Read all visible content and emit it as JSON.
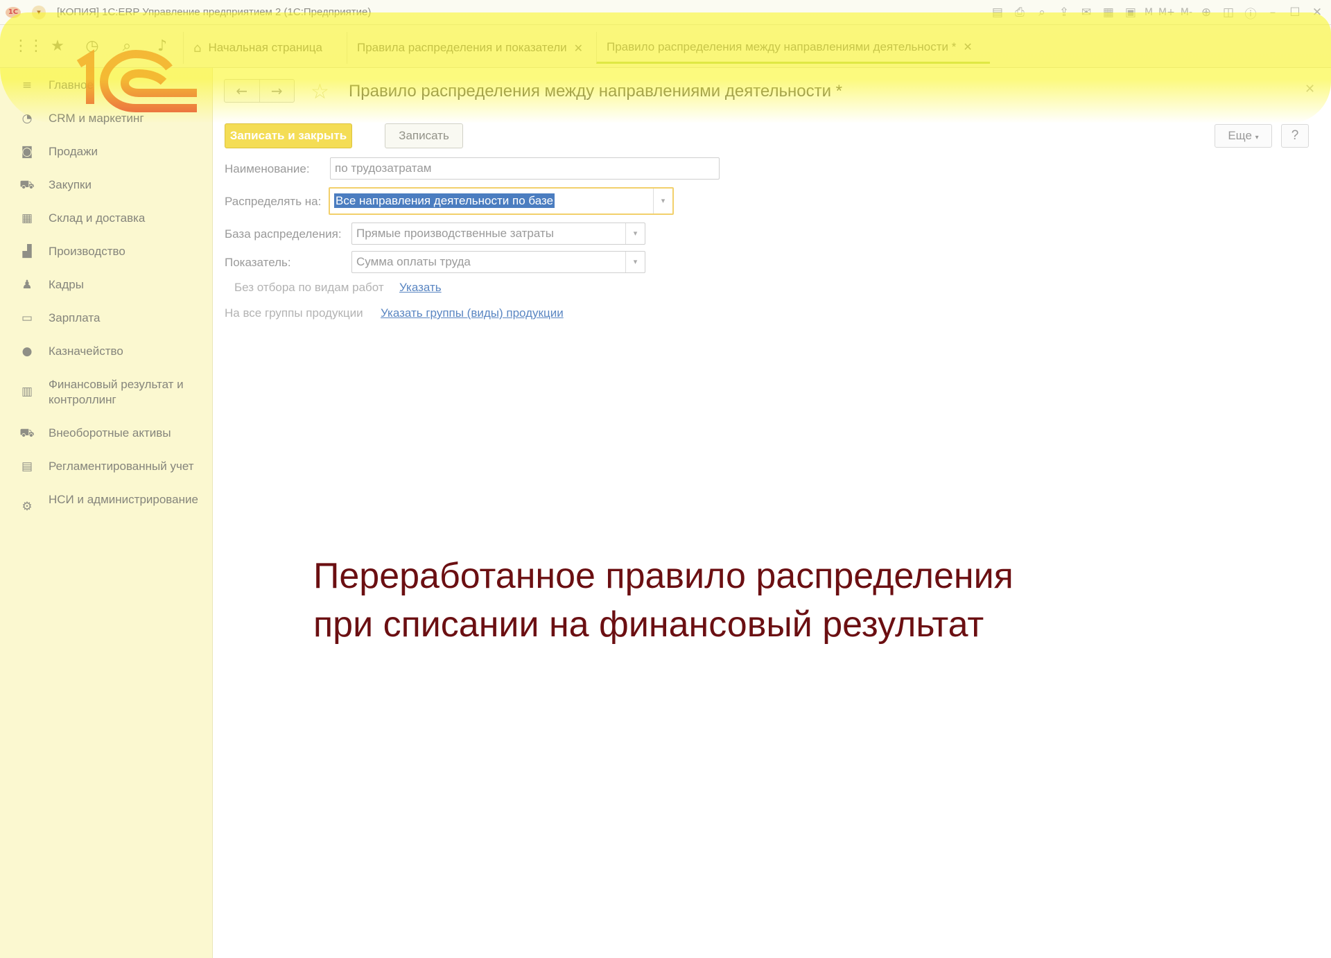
{
  "window": {
    "title": "[КОПИЯ] 1С:ERP Управление предприятием 2  (1С:Предприятие)",
    "toolbar_text": [
      "M",
      "M+",
      "M-"
    ]
  },
  "tabs": [
    {
      "label": "Начальная страница"
    },
    {
      "label": "Правила распределения и показатели"
    },
    {
      "label": "Правило распределения между направлениями деятельности *"
    }
  ],
  "sidebar": {
    "items": [
      {
        "label": "Главное",
        "icon": "menu-lines-icon"
      },
      {
        "label": "CRM и маркетинг",
        "icon": "pie-chart-icon"
      },
      {
        "label": "Продажи",
        "icon": "shopping-bag-icon"
      },
      {
        "label": "Закупки",
        "icon": "cart-icon"
      },
      {
        "label": "Склад и доставка",
        "icon": "warehouse-grid-icon"
      },
      {
        "label": "Производство",
        "icon": "factory-icon"
      },
      {
        "label": "Кадры",
        "icon": "person-icon"
      },
      {
        "label": "Зарплата",
        "icon": "card-icon"
      },
      {
        "label": "Казначейство",
        "icon": "ruble-coin-icon"
      },
      {
        "label": "Финансовый результат и контроллинг",
        "icon": "bar-chart-icon"
      },
      {
        "label": "Внеоборотные активы",
        "icon": "truck-icon"
      },
      {
        "label": "Регламентированный учет",
        "icon": "calculator-icon"
      },
      {
        "label": "НСИ и администрирование",
        "icon": "gear-icon"
      }
    ]
  },
  "form": {
    "title": "Правило распределения между направлениями деятельности *",
    "buttons": {
      "save_close": "Записать и закрыть",
      "save": "Записать",
      "more": "Еще",
      "help": "?"
    },
    "name_label": "Наименование:",
    "name_value": "по трудозатратам",
    "distribute_label": "Распределять на:",
    "distribute_value": "Все направления деятельности по базе",
    "base_label": "База распределения:",
    "base_value": "Прямые производственные затраты",
    "indicator_label": "Показатель:",
    "indicator_value": "Сумма оплаты труда",
    "work_filter_text": "Без отбора по видам работ",
    "work_filter_link": "Указать",
    "product_groups_text": "На все группы продукции",
    "product_groups_link": "Указать группы (виды) продукции"
  },
  "caption": {
    "line1": "Переработанное правило распределения",
    "line2": "при списании на финансовый результат"
  },
  "colors": {
    "highlight": "#faf628",
    "sidebar_bg": "#fbf8d0",
    "primary_button": "#f4dd55",
    "caption": "#6b0f12",
    "logo_red": "#e8452c"
  }
}
